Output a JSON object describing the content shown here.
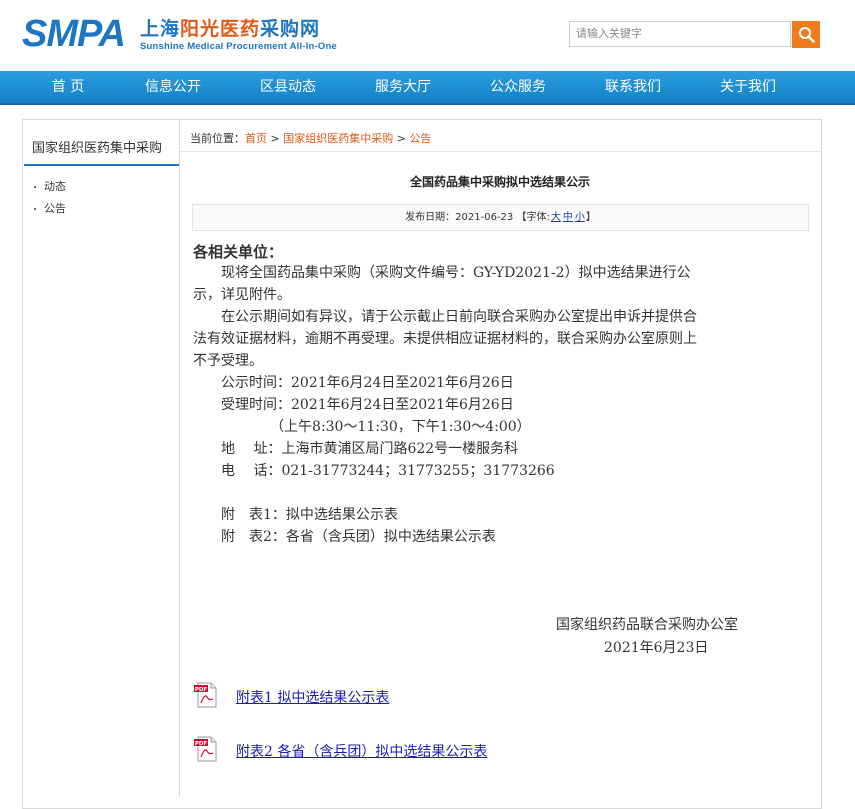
{
  "header": {
    "logo_smpa": "SMPA",
    "logo_cn_a": "上海",
    "logo_cn_b": "阳光医药",
    "logo_cn_c": "采购网",
    "logo_en": "Sunshine Medical Procurement All-In-One",
    "search_placeholder": "请输入关键字"
  },
  "nav": [
    "首 页",
    "信息公开",
    "区县动态",
    "服务大厅",
    "公众服务",
    "联系我们",
    "关于我们"
  ],
  "sidebar": {
    "title": "国家组织医药集中采购",
    "items": [
      "动态",
      "公告"
    ]
  },
  "breadcrumb": {
    "label": "当前位置：",
    "home": "首页",
    "sep1": " > ",
    "section": "国家组织医药集中采购",
    "sep2": " > ",
    "current": "公告"
  },
  "article": {
    "title": "全国药品集中采购拟中选结果公示",
    "date_label": "发布日期：",
    "date": "2021-06-23",
    "font_prefix": "【字体:",
    "font_large": "大",
    "font_medium": "中",
    "font_small": "小",
    "font_suffix": "】",
    "greeting": "各相关单位：",
    "lines": [
      "　　现将全国药品集中采购（采购文件编号：GY-YD2021-2）拟中选结果进行公",
      "示，详见附件。",
      "　　在公示期间如有异议，请于公示截止日前向联合采购办公室提出申诉并提供合",
      "法有效证据材料，逾期不再受理。未提供相应证据材料的，联合采购办公室原则上",
      "不予受理。",
      "　　公示时间：2021年6月24日至2021年6月26日",
      "　　受理时间：2021年6月24日至2021年6月26日",
      "　　　　　　（上午8:30～11:30，下午1:30～4:00）",
      "　　地　 址：上海市黄浦区局门路622号一楼服务科",
      "　　电　 话：021-31773244；31773255；31773266",
      "　　附　表1：拟中选结果公示表",
      "　　附　表2：各省（含兵团）拟中选结果公示表"
    ],
    "signature_org": "国家组织药品联合采购办公室",
    "signature_date": "2021年6月23日",
    "attachments": [
      {
        "label": "附表1 拟中选结果公示表",
        "icon_text": "PDF"
      },
      {
        "label": "附表2 各省（含兵团）拟中选结果公示表",
        "icon_text": "PDF"
      }
    ]
  },
  "colors": {
    "brand_blue": "#1d76c2",
    "accent_orange": "#e05a18",
    "nav_blue": "#1a8bd2",
    "link_blue": "#1b1bb5"
  }
}
